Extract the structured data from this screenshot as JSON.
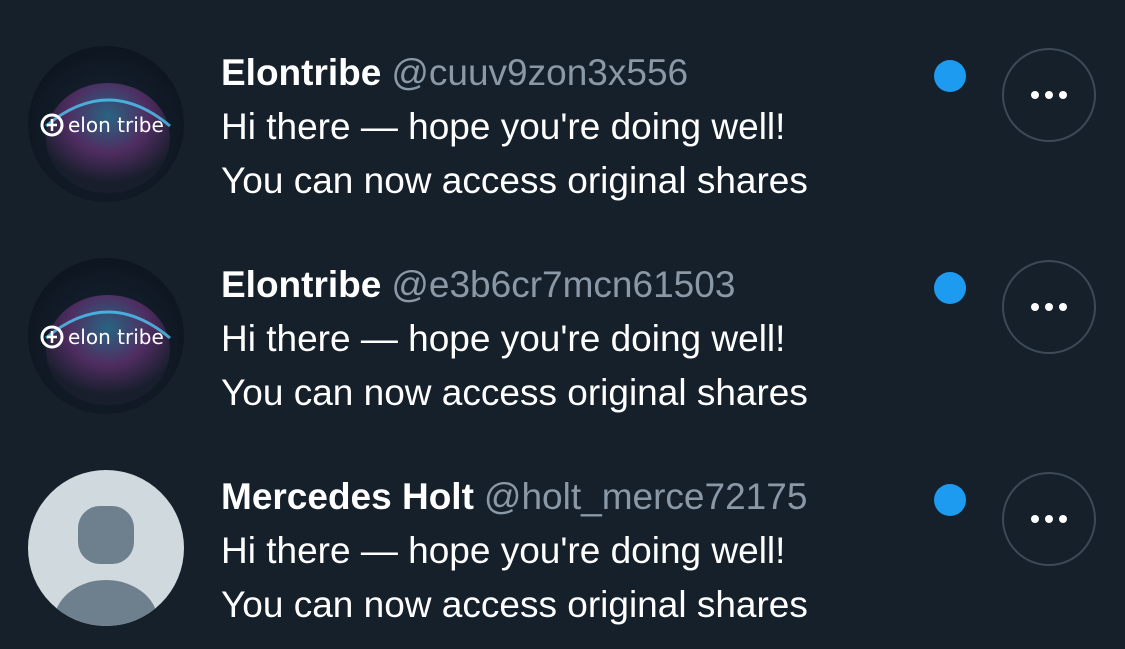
{
  "colors": {
    "background": "#15202b",
    "handle": "#8b98a5",
    "unread_dot": "#1d9bf0",
    "button_border": "#3d4a56"
  },
  "conversations": [
    {
      "display_name": "Elontribe",
      "handle": "@cuuv9zon3x556",
      "message_line1": "Hi there — hope you're doing well!",
      "message_line2": "You can now access original shares",
      "unread": true,
      "avatar": {
        "type": "logo",
        "icon": "elon-tribe-logo-icon",
        "logo_text": "elon tribe"
      }
    },
    {
      "display_name": "Elontribe",
      "handle": "@e3b6cr7mcn61503",
      "message_line1": "Hi there — hope you're doing well!",
      "message_line2": "You can now access original shares",
      "unread": true,
      "avatar": {
        "type": "logo",
        "icon": "elon-tribe-logo-icon",
        "logo_text": "elon tribe"
      }
    },
    {
      "display_name": "Mercedes Holt",
      "handle": "@holt_merce72175",
      "message_line1": "Hi there — hope you're doing well!",
      "message_line2": "You can now access original shares",
      "unread": true,
      "avatar": {
        "type": "default",
        "icon": "default-avatar-icon"
      }
    }
  ]
}
